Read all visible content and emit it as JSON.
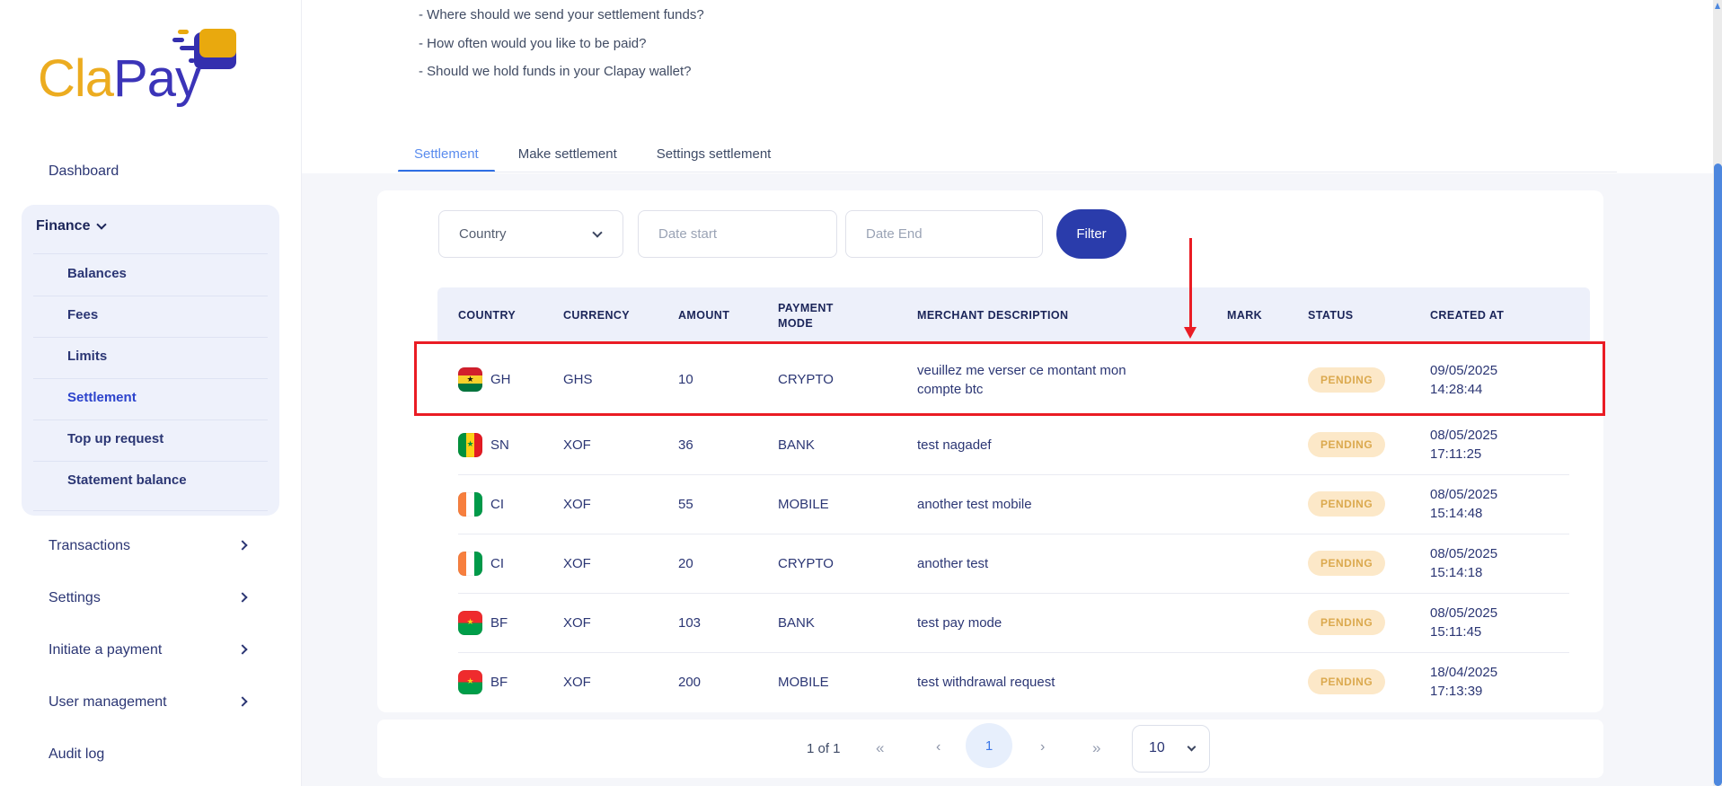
{
  "brand": {
    "name_part1": "Cla",
    "name_part2": "Pay"
  },
  "sidebar": {
    "dashboard": "Dashboard",
    "finance": {
      "label": "Finance",
      "children": [
        {
          "label": "Balances",
          "active": false
        },
        {
          "label": "Fees",
          "active": false
        },
        {
          "label": "Limits",
          "active": false
        },
        {
          "label": "Settlement",
          "active": true
        },
        {
          "label": "Top up request",
          "active": false
        },
        {
          "label": "Statement balance",
          "active": false
        }
      ]
    },
    "transactions": "Transactions",
    "settings": "Settings",
    "initiate_payment": "Initiate a payment",
    "user_management": "User management",
    "audit_log": "Audit log"
  },
  "intro": {
    "questions": [
      "- Where should we send your settlement funds?",
      "- How often would you like to be paid?",
      "- Should we hold funds in your Clapay wallet?"
    ]
  },
  "tabs": [
    {
      "label": "Settlement",
      "active": true
    },
    {
      "label": "Make settlement",
      "active": false
    },
    {
      "label": "Settings settlement",
      "active": false
    }
  ],
  "filters": {
    "country_placeholder": "Country",
    "date_start_placeholder": "Date start",
    "date_end_placeholder": "Date End",
    "filter_button": "Filter"
  },
  "table": {
    "columns": [
      "COUNTRY",
      "CURRENCY",
      "AMOUNT",
      "PAYMENT MODE",
      "MERCHANT DESCRIPTION",
      "MARK",
      "STATUS",
      "CREATED AT"
    ],
    "rows": [
      {
        "country": "GH",
        "flag_class": "flag gh",
        "currency": "GHS",
        "amount": "10",
        "payment_mode": "CRYPTO",
        "description": "veuillez me verser ce montant mon compte btc",
        "mark": "",
        "status": "PENDING",
        "created_date": "09/05/2025",
        "created_time": "14:28:44",
        "highlighted": true
      },
      {
        "country": "SN",
        "flag_class": "flag sn",
        "currency": "XOF",
        "amount": "36",
        "payment_mode": "BANK",
        "description": "test nagadef",
        "mark": "",
        "status": "PENDING",
        "created_date": "08/05/2025",
        "created_time": "17:11:25",
        "highlighted": false
      },
      {
        "country": "CI",
        "flag_class": "flag ci",
        "currency": "XOF",
        "amount": "55",
        "payment_mode": "MOBILE",
        "description": "another test mobile",
        "mark": "",
        "status": "PENDING",
        "created_date": "08/05/2025",
        "created_time": "15:14:48",
        "highlighted": false
      },
      {
        "country": "CI",
        "flag_class": "flag ci",
        "currency": "XOF",
        "amount": "20",
        "payment_mode": "CRYPTO",
        "description": "another test",
        "mark": "",
        "status": "PENDING",
        "created_date": "08/05/2025",
        "created_time": "15:14:18",
        "highlighted": false
      },
      {
        "country": "BF",
        "flag_class": "flag bf",
        "currency": "XOF",
        "amount": "103",
        "payment_mode": "BANK",
        "description": "test pay mode",
        "mark": "",
        "status": "PENDING",
        "created_date": "08/05/2025",
        "created_time": "15:11:45",
        "highlighted": false
      },
      {
        "country": "BF",
        "flag_class": "flag bf",
        "currency": "XOF",
        "amount": "200",
        "payment_mode": "MOBILE",
        "description": "test withdrawal request",
        "mark": "",
        "status": "PENDING",
        "created_date": "18/04/2025",
        "created_time": "17:13:39",
        "highlighted": false
      }
    ]
  },
  "pagination": {
    "page_info": "1 of 1",
    "first_icon": "«",
    "prev_icon": "‹",
    "current_page": "1",
    "next_icon": "›",
    "last_icon": "»",
    "page_size": "10"
  },
  "colors": {
    "accent_blue": "#2f6fe4",
    "navy_text": "#2b3674",
    "filter_button_bg": "#2a3cab",
    "pending_badge_bg": "#fce8c8",
    "pending_badge_text": "#dba94e",
    "annotation_red": "#ea1c24",
    "brand_gold": "#ecac20",
    "brand_blue": "#3b34b8",
    "scrollbar_thumb": "#4d87de"
  }
}
